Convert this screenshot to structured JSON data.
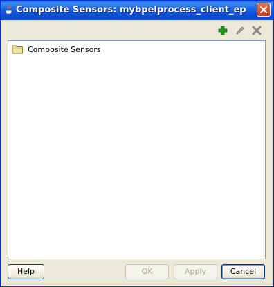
{
  "window": {
    "title": "Composite Sensors: mybpelprocess_client_ep"
  },
  "toolbar": {
    "add_icon": "plus-icon",
    "edit_icon": "pencil-icon",
    "delete_icon": "x-icon"
  },
  "tree": {
    "root_label": "Composite Sensors",
    "root_icon": "folder-icon"
  },
  "buttons": {
    "help": "Help",
    "ok": "OK",
    "apply": "Apply",
    "cancel": "Cancel"
  },
  "colors": {
    "titlebar": "#0b4fd4",
    "dialog_bg": "#ece9d8",
    "add": "#1c9e1c",
    "close": "#c7381b"
  }
}
